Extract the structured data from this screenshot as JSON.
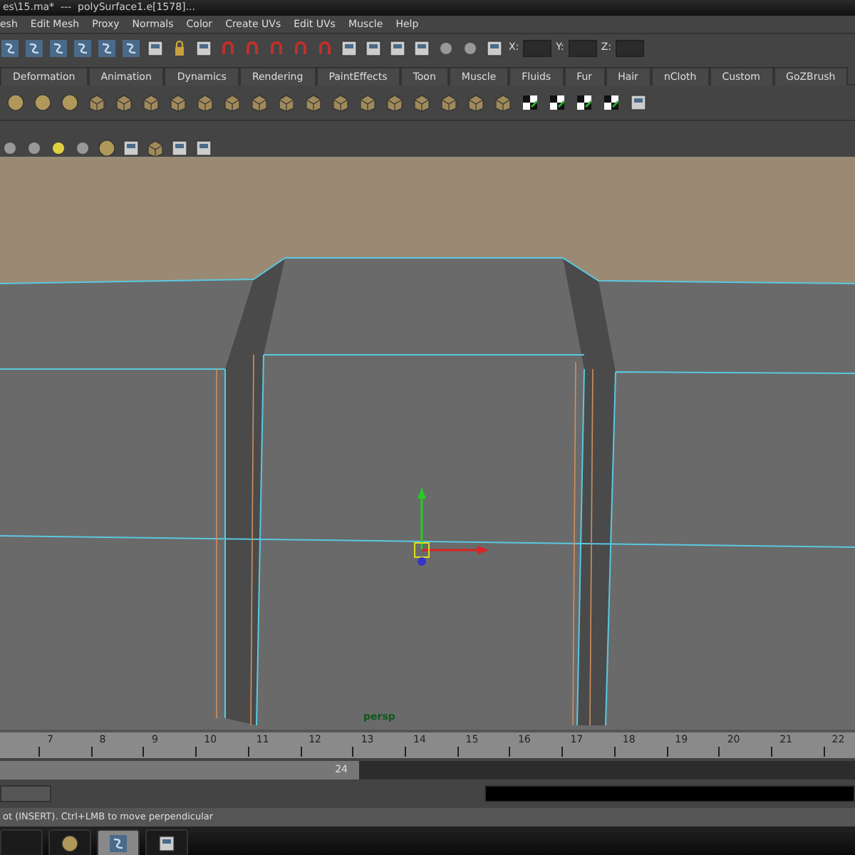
{
  "window": {
    "title": "es\\15.ma*  ---  polySurface1.e[1578]..."
  },
  "menu_bar": [
    "esh",
    "Edit Mesh",
    "Proxy",
    "Normals",
    "Color",
    "Create UVs",
    "Edit UVs",
    "Muscle",
    "Help"
  ],
  "status_line": {
    "fields": [
      {
        "label": "X:"
      },
      {
        "label": "Y:"
      },
      {
        "label": "Z:"
      }
    ]
  },
  "shelf_tabs": [
    "Deformation",
    "Animation",
    "Dynamics",
    "Rendering",
    "PaintEffects",
    "Toon",
    "Muscle",
    "Fluids",
    "Fur",
    "Hair",
    "nCloth",
    "Custom",
    "GoZBrush"
  ],
  "viewport": {
    "camera_label": "persp"
  },
  "time_slider": {
    "frames": [
      "7",
      "8",
      "9",
      "10",
      "11",
      "12",
      "13",
      "14",
      "15",
      "16",
      "17",
      "18",
      "19",
      "20",
      "21",
      "22"
    ]
  },
  "range_slider": {
    "end_frame": "24",
    "level": 0.42
  },
  "help_line": "ot (INSERT).  Ctrl+LMB to move perpendicular"
}
